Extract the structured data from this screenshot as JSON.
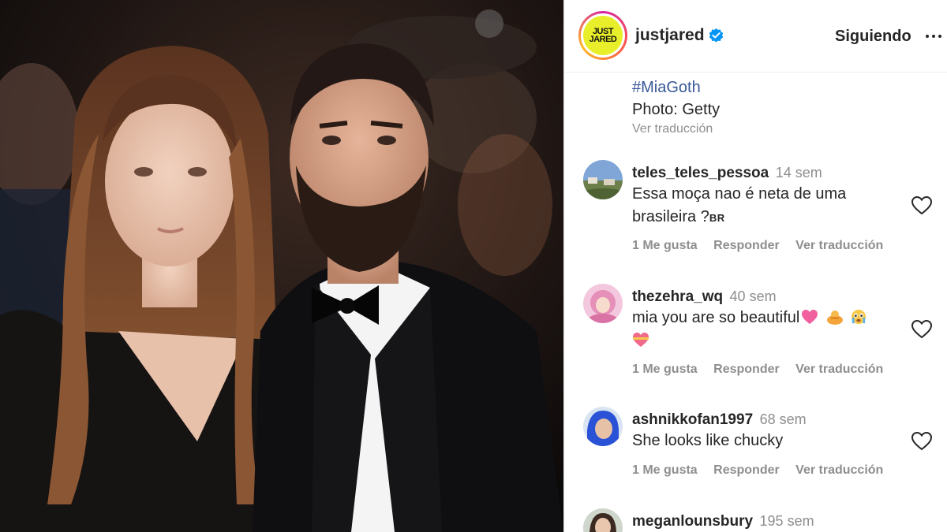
{
  "post": {
    "username": "justjared",
    "logo_text_line1": "JUST",
    "logo_text_line2": "JARED",
    "follow_label": "Siguiendo",
    "caption": {
      "hashtag": "#MiaGoth",
      "credit": "Photo: Getty",
      "translate": "Ver traducción"
    }
  },
  "comments": [
    {
      "user": "teles_teles_pessoa",
      "time": "14 sem",
      "text_line1": "Essa moça nao é neta de uma",
      "text_line2": "brasileira ?",
      "flag": "BR",
      "likes": "1 Me gusta",
      "reply": "Responder",
      "translate": "Ver traducción"
    },
    {
      "user": "thezehra_wq",
      "time": "40 sem",
      "text_line1": "mia you are so beautiful",
      "likes": "1 Me gusta",
      "reply": "Responder",
      "translate": "Ver traducción"
    },
    {
      "user": "ashnikkofan1997",
      "time": "68 sem",
      "text_line1": "She looks like chucky",
      "likes": "1 Me gusta",
      "reply": "Responder",
      "translate": "Ver traducción"
    },
    {
      "user": "meganlounsbury",
      "time": "195 sem"
    }
  ],
  "icons": {
    "verified": "verified-badge-icon",
    "more": "more-options-icon",
    "like": "heart-icon"
  },
  "colors": {
    "logo_yellow": "#e8ef2a",
    "verified_blue": "#0095f6",
    "hashtag_blue": "#385898",
    "muted": "#8e8e8e"
  }
}
